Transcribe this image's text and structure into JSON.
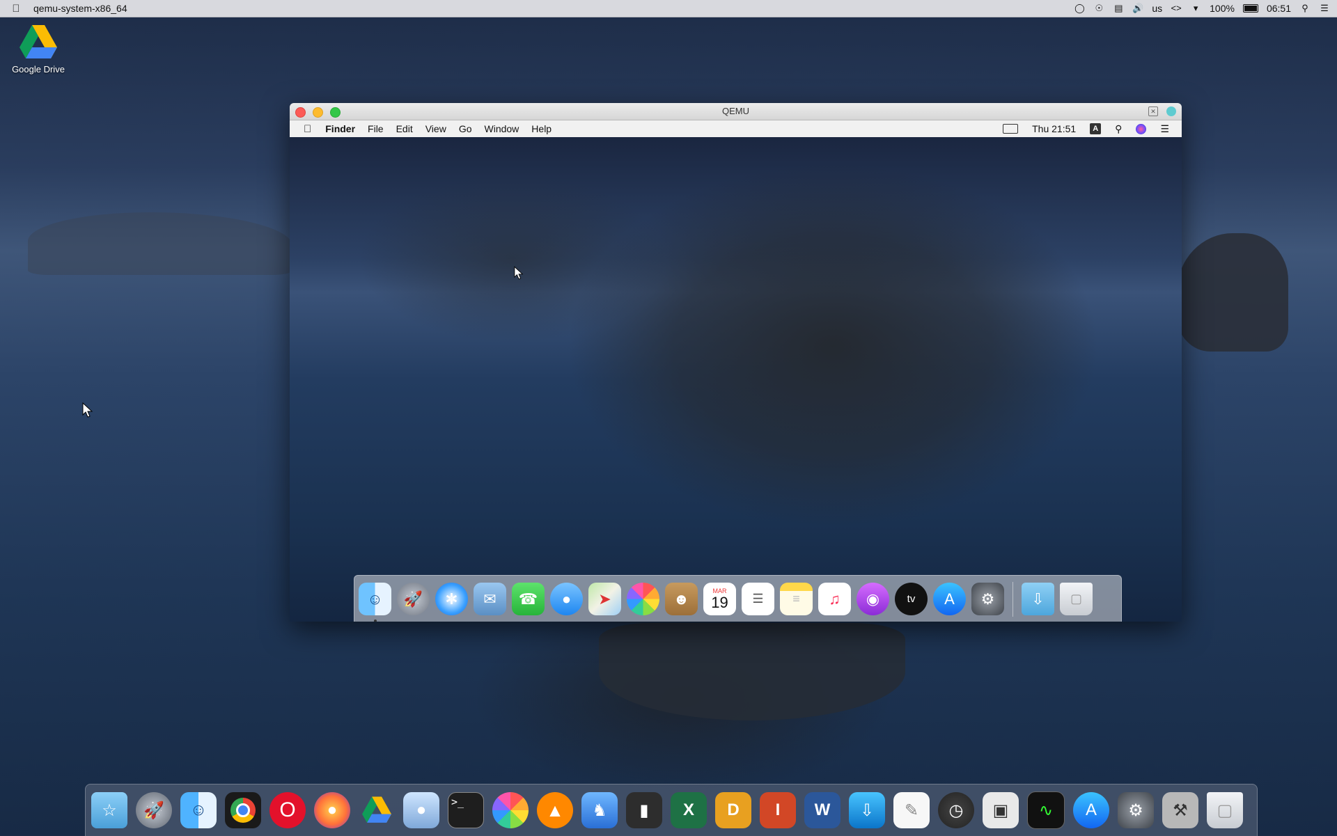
{
  "host_menubar": {
    "app_name": "qemu-system-x86_64",
    "status": {
      "keyboard": "us",
      "battery": "100%",
      "time": "06:51"
    }
  },
  "desktop_icons": [
    {
      "label": "Google Drive",
      "icon": "google-drive-icon"
    }
  ],
  "qemu_window": {
    "title": "QEMU",
    "guest_menubar": {
      "app_name": "Finder",
      "menus": [
        "File",
        "Edit",
        "View",
        "Go",
        "Window",
        "Help"
      ],
      "clock": "Thu 21:51",
      "input_badge": "A"
    },
    "guest_dock": {
      "apps": [
        {
          "name": "finder-icon",
          "running": true
        },
        {
          "name": "launchpad-icon"
        },
        {
          "name": "safari-icon"
        },
        {
          "name": "mail-icon"
        },
        {
          "name": "facetime-icon"
        },
        {
          "name": "messages-icon"
        },
        {
          "name": "maps-icon"
        },
        {
          "name": "photos-icon"
        },
        {
          "name": "contacts-icon"
        },
        {
          "name": "calendar-icon",
          "calendar_month": "MAR",
          "calendar_day": "19"
        },
        {
          "name": "reminders-icon"
        },
        {
          "name": "notes-icon"
        },
        {
          "name": "music-icon"
        },
        {
          "name": "podcasts-icon"
        },
        {
          "name": "apple-tv-icon",
          "text": "tv"
        },
        {
          "name": "app-store-icon"
        },
        {
          "name": "system-preferences-icon"
        }
      ],
      "stack": [
        {
          "name": "downloads-folder-icon"
        },
        {
          "name": "trash-icon"
        }
      ]
    }
  },
  "host_dock": {
    "apps": [
      {
        "name": "favorites-folder-icon"
      },
      {
        "name": "launchpad-icon"
      },
      {
        "name": "finder-icon"
      },
      {
        "name": "chrome-icon"
      },
      {
        "name": "opera-icon"
      },
      {
        "name": "firefox-icon"
      },
      {
        "name": "google-drive-icon"
      },
      {
        "name": "preview-icon"
      },
      {
        "name": "terminal-icon",
        "text": ">_"
      },
      {
        "name": "photos-icon"
      },
      {
        "name": "vlc-icon"
      },
      {
        "name": "migration-assistant-icon"
      },
      {
        "name": "document-icon"
      },
      {
        "name": "excel-icon",
        "text": "X"
      },
      {
        "name": "dictionary-icon",
        "text": "D"
      },
      {
        "name": "powerpoint-icon",
        "text": "I"
      },
      {
        "name": "word-icon",
        "text": "W"
      },
      {
        "name": "downloader-icon"
      },
      {
        "name": "textedit-icon"
      },
      {
        "name": "time-machine-icon"
      },
      {
        "name": "screenshot-icon"
      },
      {
        "name": "activity-monitor-icon"
      },
      {
        "name": "app-store-icon"
      },
      {
        "name": "system-preferences-icon"
      },
      {
        "name": "utilities-icon"
      },
      {
        "name": "trash-icon"
      }
    ]
  },
  "colors": {
    "accent": "#1b7cf0",
    "close": "#fc5b57",
    "minimize": "#fdbb2e",
    "maximize": "#33c748"
  }
}
